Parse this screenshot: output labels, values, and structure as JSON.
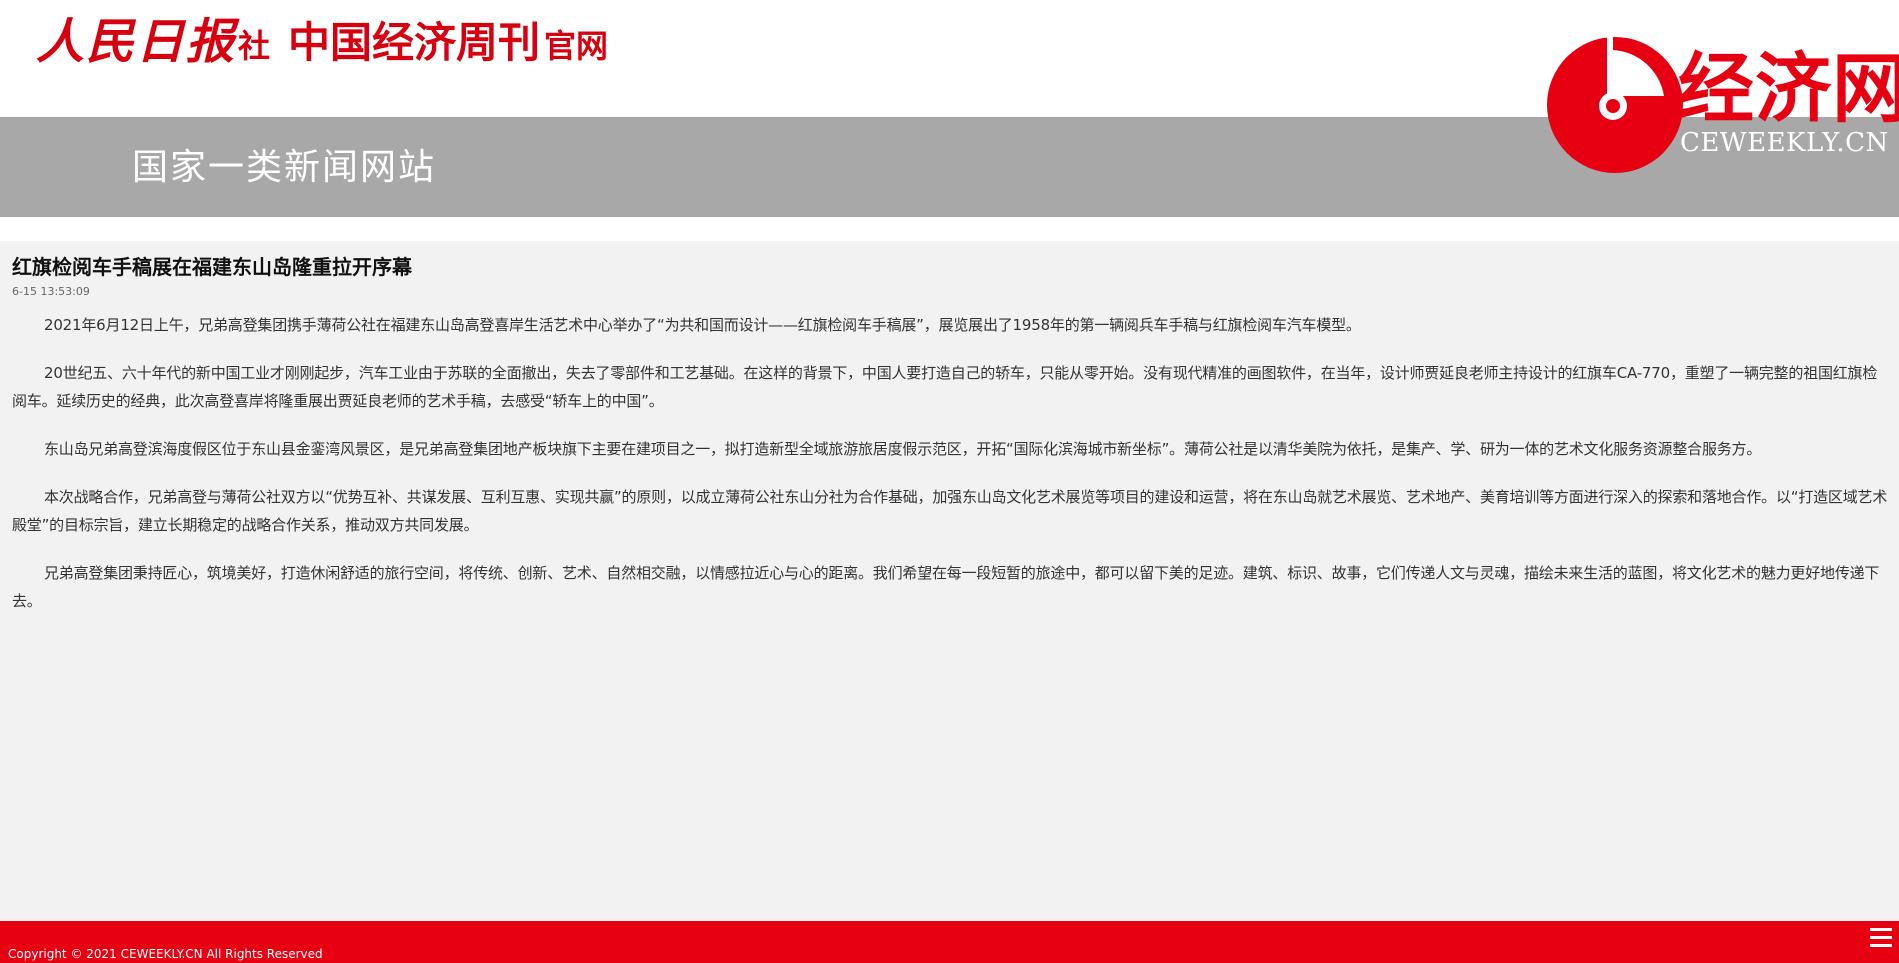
{
  "header": {
    "masthead_people_daily": "人民日报",
    "masthead_she": "社",
    "masthead_weekly": "中国经济周刊",
    "masthead_official": "官网",
    "slogan": "国家一类新闻网站",
    "logo_name": "经济网",
    "logo_domain": "CEWEEKLY.CN"
  },
  "article": {
    "title": "红旗检阅车手稿展在福建东山岛隆重拉开序幕",
    "date": "6-15 13:53:09",
    "paragraphs": [
      "2021年6月12日上午，兄弟高登集团携手薄荷公社在福建东山岛高登喜岸生活艺术中心举办了“为共和国而设计——红旗检阅车手稿展”，展览展出了1958年的第一辆阅兵车手稿与红旗检阅车汽车模型。",
      "20世纪五、六十年代的新中国工业才刚刚起步，汽车工业由于苏联的全面撤出，失去了零部件和工艺基础。在这样的背景下，中国人要打造自己的轿车，只能从零开始。没有现代精准的画图软件，在当年，设计师贾延良老师主持设计的红旗车CA-770，重塑了一辆完整的祖国红旗检阅车。延续历史的经典，此次高登喜岸将隆重展出贾延良老师的艺术手稿，去感受“轿车上的中国”。",
      "东山岛兄弟高登滨海度假区位于东山县金銮湾风景区，是兄弟高登集团地产板块旗下主要在建项目之一，拟打造新型全域旅游旅居度假示范区，开拓“国际化滨海城市新坐标”。薄荷公社是以清华美院为依托，是集产、学、研为一体的艺术文化服务资源整合服务方。",
      "本次战略合作，兄弟高登与薄荷公社双方以“优势互补、共谋发展、互利互惠、实现共赢”的原则，以成立薄荷公社东山分社为合作基础，加强东山岛文化艺术展览等项目的建设和运营，将在东山岛就艺术展览、艺术地产、美育培训等方面进行深入的探索和落地合作。以“打造区域艺术殿堂”的目标宗旨，建立长期稳定的战略合作关系，推动双方共同发展。",
      "兄弟高登集团秉持匠心，筑境美好，打造休闲舒适的旅行空间，将传统、创新、艺术、自然相交融，以情感拉近心与心的距离。我们希望在每一段短暂的旅途中，都可以留下美的足迹。建筑、标识、故事，它们传递人文与灵魂，描绘未来生活的蓝图，将文化艺术的魅力更好地传递下去。"
    ]
  },
  "footer": {
    "copyright": "Copyright © 2021 CEWEEKLY.CN All Rights Reserved",
    "menu_icon": "hamburger-menu-icon"
  },
  "colors": {
    "brand_red": "#e60012",
    "band_gray": "#a8a8a8",
    "article_bg": "#f2f2f2"
  }
}
